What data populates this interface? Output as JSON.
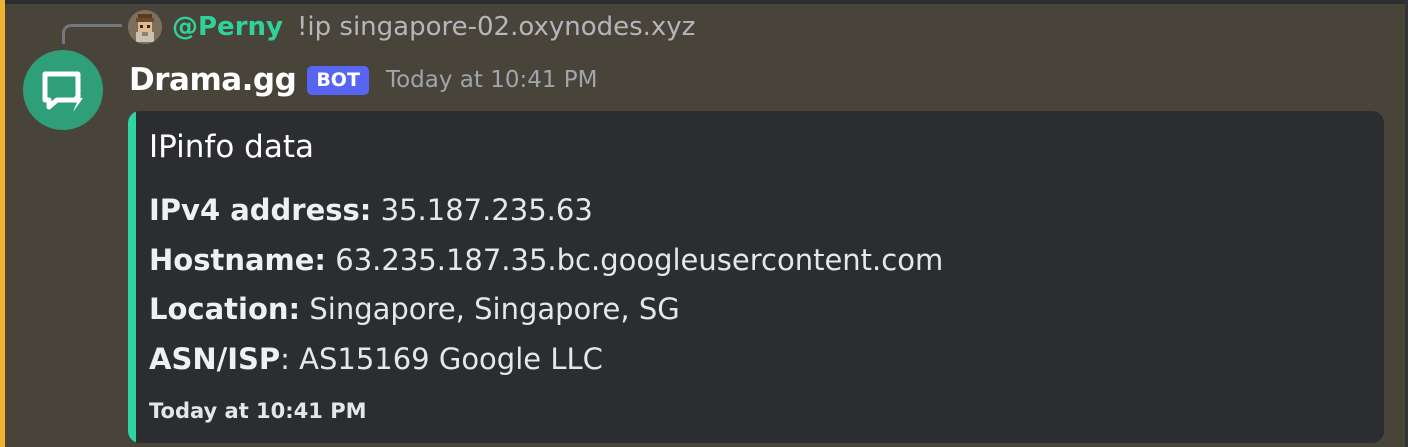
{
  "reply": {
    "author": "@Perny",
    "content": "!ip singapore-02.oxynodes.xyz"
  },
  "message": {
    "username": "Drama.gg",
    "bot_tag": "BOT",
    "timestamp": "Today at 10:41 PM"
  },
  "embed": {
    "accent_color": "#2fd6a4",
    "title": "IPinfo data",
    "fields": [
      {
        "label": "IPv4 address:",
        "separator": "",
        "value": " 35.187.235.63"
      },
      {
        "label": "Hostname:",
        "separator": "",
        "value": " 63.235.187.35.bc.googleusercontent.com"
      },
      {
        "label": "Location:",
        "separator": "",
        "value": " Singapore, Singapore, SG"
      },
      {
        "label": "ASN/ISP",
        "separator": ":",
        "value": " AS15169 Google LLC"
      }
    ],
    "footer": "Today at 10:41 PM"
  },
  "colors": {
    "background": "#49443a",
    "mention_bar": "#f0b232",
    "reply_author": "#2fd29a",
    "bot_tag": "#5865f2",
    "bot_avatar": "#2f9f79"
  },
  "icons": {
    "reply_avatar": "pixel-character-avatar",
    "bot_avatar": "chat-bubble-lightning-icon"
  }
}
